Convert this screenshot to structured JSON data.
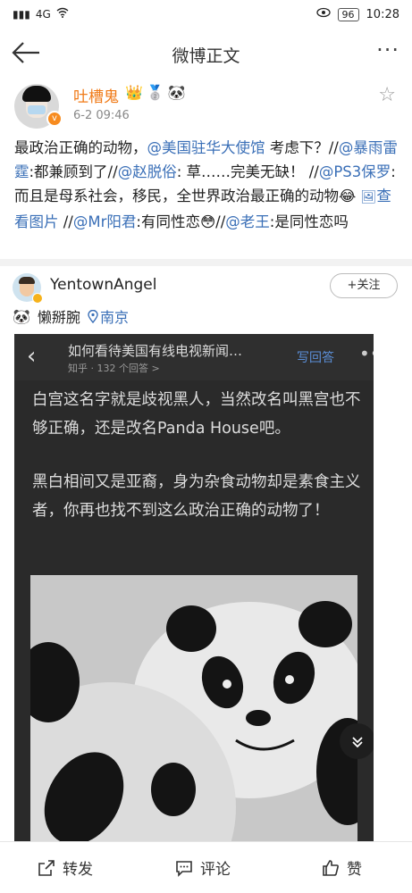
{
  "statusbar": {
    "network": "4G",
    "battery": "96",
    "time": "10:28"
  },
  "nav": {
    "title": "微博正文"
  },
  "post": {
    "username": "吐槽鬼",
    "time": "6-2 09:46",
    "content": [
      {
        "t": "text",
        "v": "最政治正确的动物，"
      },
      {
        "t": "at",
        "v": "@美国驻华大使馆"
      },
      {
        "t": "text",
        "v": " 考虑下？//"
      },
      {
        "t": "at",
        "v": "@暴雨雷霆"
      },
      {
        "t": "text",
        "v": ":都兼顾到了//"
      },
      {
        "t": "at",
        "v": "@赵脱俗"
      },
      {
        "t": "text",
        "v": ": 草……完美无缺！ //"
      },
      {
        "t": "at",
        "v": "@PS3保罗"
      },
      {
        "t": "text",
        "v": ": 而且是母系社会，移民，全世界政治最正确的动物😂 "
      },
      {
        "t": "link",
        "v": "查看图片"
      },
      {
        "t": "text",
        "v": "  //"
      },
      {
        "t": "at",
        "v": "@Mr阳君"
      },
      {
        "t": "text",
        "v": ":有同性恋😳//"
      },
      {
        "t": "at",
        "v": "@老王"
      },
      {
        "t": "text",
        "v": ":是同性恋吗"
      }
    ]
  },
  "repost": {
    "username": "YentownAngel",
    "follow_label": "+关注",
    "location_prefix": "懒掰腕",
    "location": "南京",
    "screenshot": {
      "title": "如何看待美国有线电视新闻…",
      "subtitle": "知乎 · 132 个回答 >",
      "answer_button": "写回答",
      "paragraph1": "白宫这名字就是歧视黑人，当然改名叫黑宫也不够正确，还是改名Panda House吧。",
      "paragraph2": "黑白相间又是亚裔，身为杂食动物却是素食主义者，你再也找不到这么政治正确的动物了！"
    }
  },
  "bottombar": {
    "repost_label": "转发",
    "comment_label": "评论",
    "like_label": "赞"
  }
}
